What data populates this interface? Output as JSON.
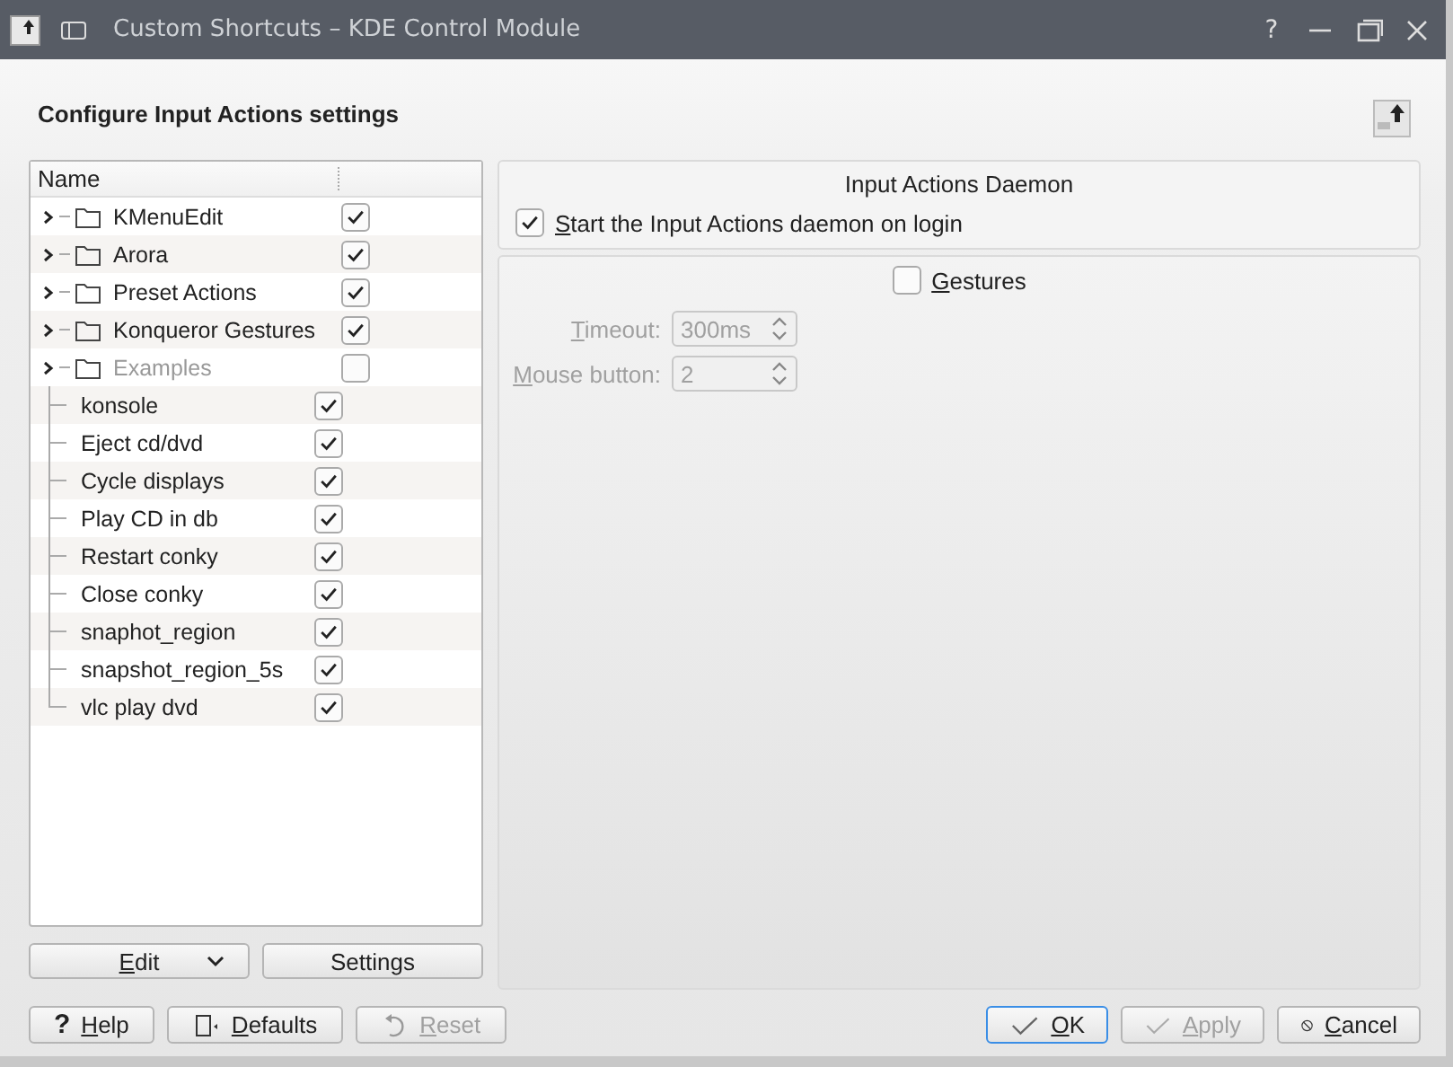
{
  "window": {
    "title": "Custom Shortcuts – KDE Control Module",
    "controls": [
      "?"
    ]
  },
  "header": {
    "title": "Configure Input Actions settings"
  },
  "tree": {
    "columns": [
      "Name"
    ],
    "items": [
      {
        "label": "KMenuEdit",
        "kind": "folder",
        "checked": true,
        "disabled": false,
        "expanded": false
      },
      {
        "label": "Arora",
        "kind": "folder",
        "checked": true,
        "disabled": false,
        "expanded": false
      },
      {
        "label": "Preset Actions",
        "kind": "folder",
        "checked": true,
        "disabled": false,
        "expanded": false
      },
      {
        "label": "Konqueror Gestures",
        "kind": "folder",
        "checked": true,
        "disabled": false,
        "expanded": false
      },
      {
        "label": "Examples",
        "kind": "folder",
        "checked": false,
        "disabled": true,
        "expanded": false
      },
      {
        "label": "konsole",
        "kind": "action",
        "checked": true,
        "disabled": false
      },
      {
        "label": "Eject cd/dvd",
        "kind": "action",
        "checked": true,
        "disabled": false
      },
      {
        "label": "Cycle displays",
        "kind": "action",
        "checked": true,
        "disabled": false
      },
      {
        "label": "Play CD in db",
        "kind": "action",
        "checked": true,
        "disabled": false
      },
      {
        "label": "Restart conky",
        "kind": "action",
        "checked": true,
        "disabled": false
      },
      {
        "label": "Close conky",
        "kind": "action",
        "checked": true,
        "disabled": false
      },
      {
        "label": "snaphot_region",
        "kind": "action",
        "checked": true,
        "disabled": false
      },
      {
        "label": "snapshot_region_5s",
        "kind": "action",
        "checked": true,
        "disabled": false
      },
      {
        "label": "vlc play dvd",
        "kind": "action",
        "checked": true,
        "disabled": false
      }
    ]
  },
  "tree_buttons": [
    {
      "label": "Edit",
      "kind": "menu",
      "underline_first": true
    },
    {
      "label": "Settings",
      "kind": "plain",
      "underline_first": false
    }
  ],
  "daemon": {
    "title": "Input Actions Daemon",
    "start_on_login": {
      "label": "Start the Input Actions daemon on login",
      "checked": true,
      "underline_first": true
    }
  },
  "gestures": {
    "label": "Gestures",
    "checked": false,
    "underline_first": true,
    "fields": [
      {
        "label": "Timeout:",
        "value": "300ms",
        "disabled": true,
        "underline_first": true
      },
      {
        "label": "Mouse button:",
        "value": "2",
        "disabled": true,
        "underline_first": true
      }
    ]
  },
  "footer_left": [
    {
      "label": "Help",
      "kind": "help",
      "glyph": "?",
      "disabled": false,
      "underline_first": true
    },
    {
      "label": "Defaults",
      "kind": "defaults",
      "disabled": false,
      "underline_first": true
    },
    {
      "label": "Reset",
      "kind": "reset",
      "disabled": true,
      "underline_first": true
    }
  ],
  "footer_right": [
    {
      "label": "OK",
      "kind": "check",
      "disabled": false,
      "default": true,
      "underline_first": true
    },
    {
      "label": "Apply",
      "kind": "check",
      "disabled": true,
      "default": false,
      "underline_first": true
    },
    {
      "label": "Cancel",
      "kind": "cancel",
      "disabled": false,
      "default": false,
      "underline_first": true
    }
  ]
}
